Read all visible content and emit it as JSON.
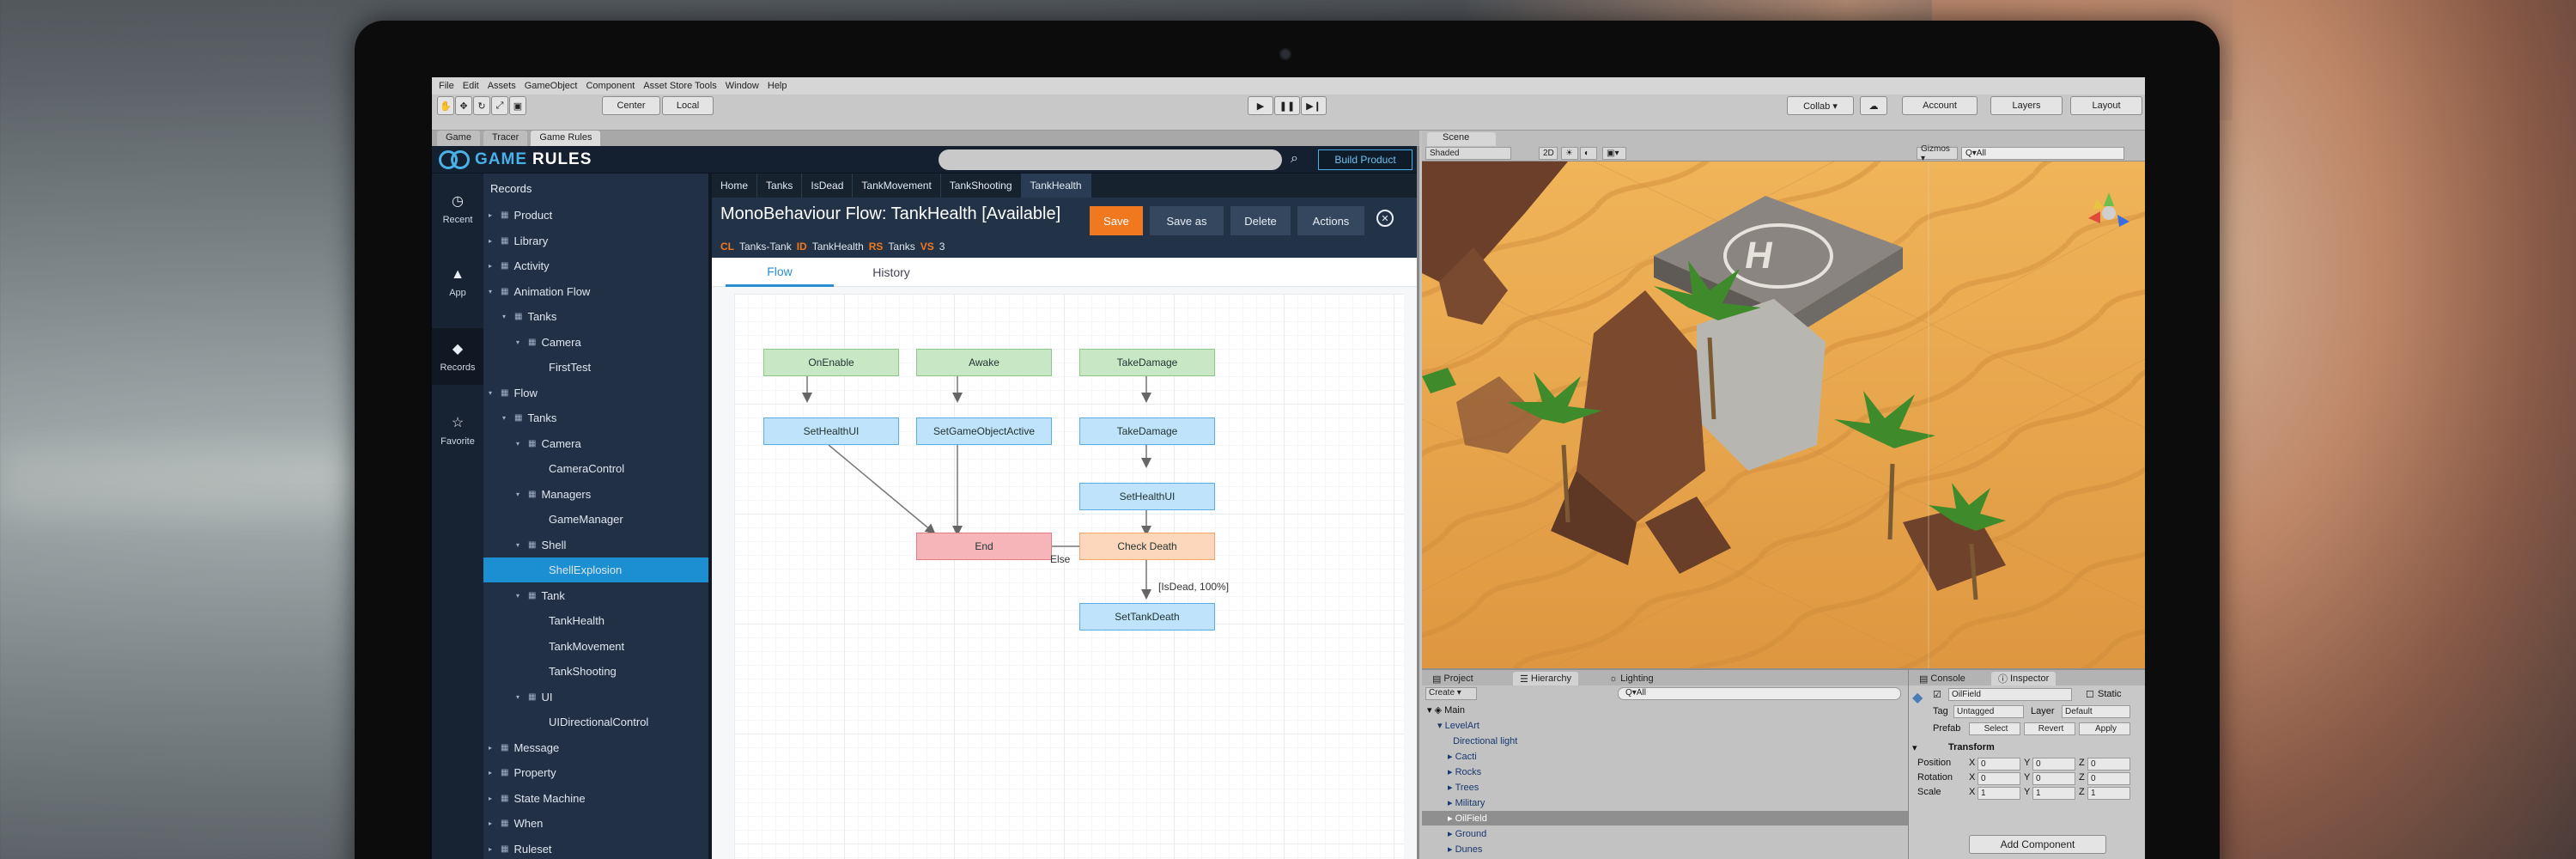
{
  "menu": [
    "File",
    "Edit",
    "Assets",
    "GameObject",
    "Component",
    "Asset Store Tools",
    "Window",
    "Help"
  ],
  "unity_toolbar": {
    "center_label": "Center",
    "local_label": "Local",
    "collab_label": "Collab ▾",
    "account_label": "Account",
    "layers_label": "Layers",
    "layout_label": "Layout"
  },
  "editor_tabs": [
    "Game",
    "Tracer",
    "Game Rules"
  ],
  "app": {
    "logo": {
      "icon": "infinity-logo-icon",
      "text_part1": "GAME",
      "text_part2": "RULES"
    },
    "build_label": "Build Product",
    "rail": [
      {
        "label": "Recent",
        "icon": "clock-icon",
        "glyph": "◷"
      },
      {
        "label": "App",
        "icon": "android-icon",
        "glyph": "▲"
      },
      {
        "label": "Records",
        "icon": "stack-icon",
        "glyph": "◆"
      },
      {
        "label": "Favorite",
        "icon": "star-icon",
        "glyph": "☆"
      }
    ],
    "tree_title": "Records",
    "tree": [
      {
        "label": "Product",
        "arrow": "▸"
      },
      {
        "label": "Library",
        "arrow": "▸"
      },
      {
        "label": "Activity",
        "arrow": "▸"
      },
      {
        "label": "Animation Flow",
        "arrow": "▾"
      },
      {
        "label": "Tanks",
        "arrow": "▾"
      },
      {
        "label": "Camera",
        "arrow": "▾"
      },
      {
        "label": "FirstTest",
        "arrow": ""
      },
      {
        "label": "Flow",
        "arrow": "▾"
      },
      {
        "label": "Tanks",
        "arrow": "▾"
      },
      {
        "label": "Camera",
        "arrow": "▾"
      },
      {
        "label": "CameraControl",
        "arrow": ""
      },
      {
        "label": "Managers",
        "arrow": "▾"
      },
      {
        "label": "GameManager",
        "arrow": ""
      },
      {
        "label": "Shell",
        "arrow": "▾"
      },
      {
        "label": "ShellExplosion",
        "arrow": ""
      },
      {
        "label": "Tank",
        "arrow": "▾"
      },
      {
        "label": "TankHealth",
        "arrow": ""
      },
      {
        "label": "TankMovement",
        "arrow": ""
      },
      {
        "label": "TankShooting",
        "arrow": ""
      },
      {
        "label": "UI",
        "arrow": "▾"
      },
      {
        "label": "UIDirectionalControl",
        "arrow": ""
      },
      {
        "label": "Message",
        "arrow": "▸"
      },
      {
        "label": "Property",
        "arrow": "▸"
      },
      {
        "label": "State Machine",
        "arrow": "▸"
      },
      {
        "label": "When",
        "arrow": "▸"
      },
      {
        "label": "Ruleset",
        "arrow": "▸"
      }
    ],
    "breadcrumbs": [
      "Home",
      "Tanks",
      "IsDead",
      "TankMovement",
      "TankShooting",
      "TankHealth"
    ],
    "title": "MonoBehaviour Flow: TankHealth  [Available]",
    "actions": [
      "Save",
      "Save as",
      "Delete",
      "Actions"
    ],
    "meta": [
      {
        "key": "CL",
        "value": "Tanks-Tank"
      },
      {
        "key": "ID",
        "value": "TankHealth"
      },
      {
        "key": "RS",
        "value": "Tanks"
      },
      {
        "key": "VS",
        "value": "3"
      }
    ],
    "subtabs": [
      "Flow",
      "History"
    ],
    "flow": {
      "nodes": [
        "OnEnable",
        "Awake",
        "TakeDamage",
        "SetHealthUI",
        "SetGameObjectActive",
        "TakeDamage",
        "SetHealthUI",
        "End",
        "Check Death",
        "SetTankDeath"
      ],
      "edge_labels": {
        "else": "Else",
        "condition": "[IsDead, 100%]"
      }
    },
    "accent": "#f0781e",
    "selected_color": "#1b8fd2"
  },
  "scene": {
    "tab": "Scene",
    "shading": "Shaded",
    "mode2d": "2D",
    "gizmos": "Gizmos ▾",
    "search_placeholder": "Q▾All"
  },
  "hierarchy": {
    "tabs": [
      "Project",
      "Hierarchy",
      "Lighting"
    ],
    "create": "Create ▾",
    "search_placeholder": "Q▾All",
    "root": "Main",
    "rows": [
      "LevelArt",
      "Directional light",
      "Cacti",
      "Rocks",
      "Trees",
      "Military",
      "OilField",
      "Ground",
      "Dunes"
    ]
  },
  "inspector": {
    "tabs": [
      "Console",
      "Inspector"
    ],
    "object_name": "OilField",
    "static_label": "Static",
    "tag_label": "Tag",
    "tag_value": "Untagged",
    "layer_label": "Layer",
    "layer_value": "Default",
    "prefab_label": "Prefab",
    "prefab_buttons": [
      "Select",
      "Revert",
      "Apply"
    ],
    "transform_label": "Transform",
    "rows": [
      {
        "label": "Position",
        "x": "0",
        "y": "0",
        "z": "0"
      },
      {
        "label": "Rotation",
        "x": "0",
        "y": "0",
        "z": "0"
      },
      {
        "label": "Scale",
        "x": "1",
        "y": "1",
        "z": "1"
      }
    ],
    "add_component": "Add Component"
  }
}
